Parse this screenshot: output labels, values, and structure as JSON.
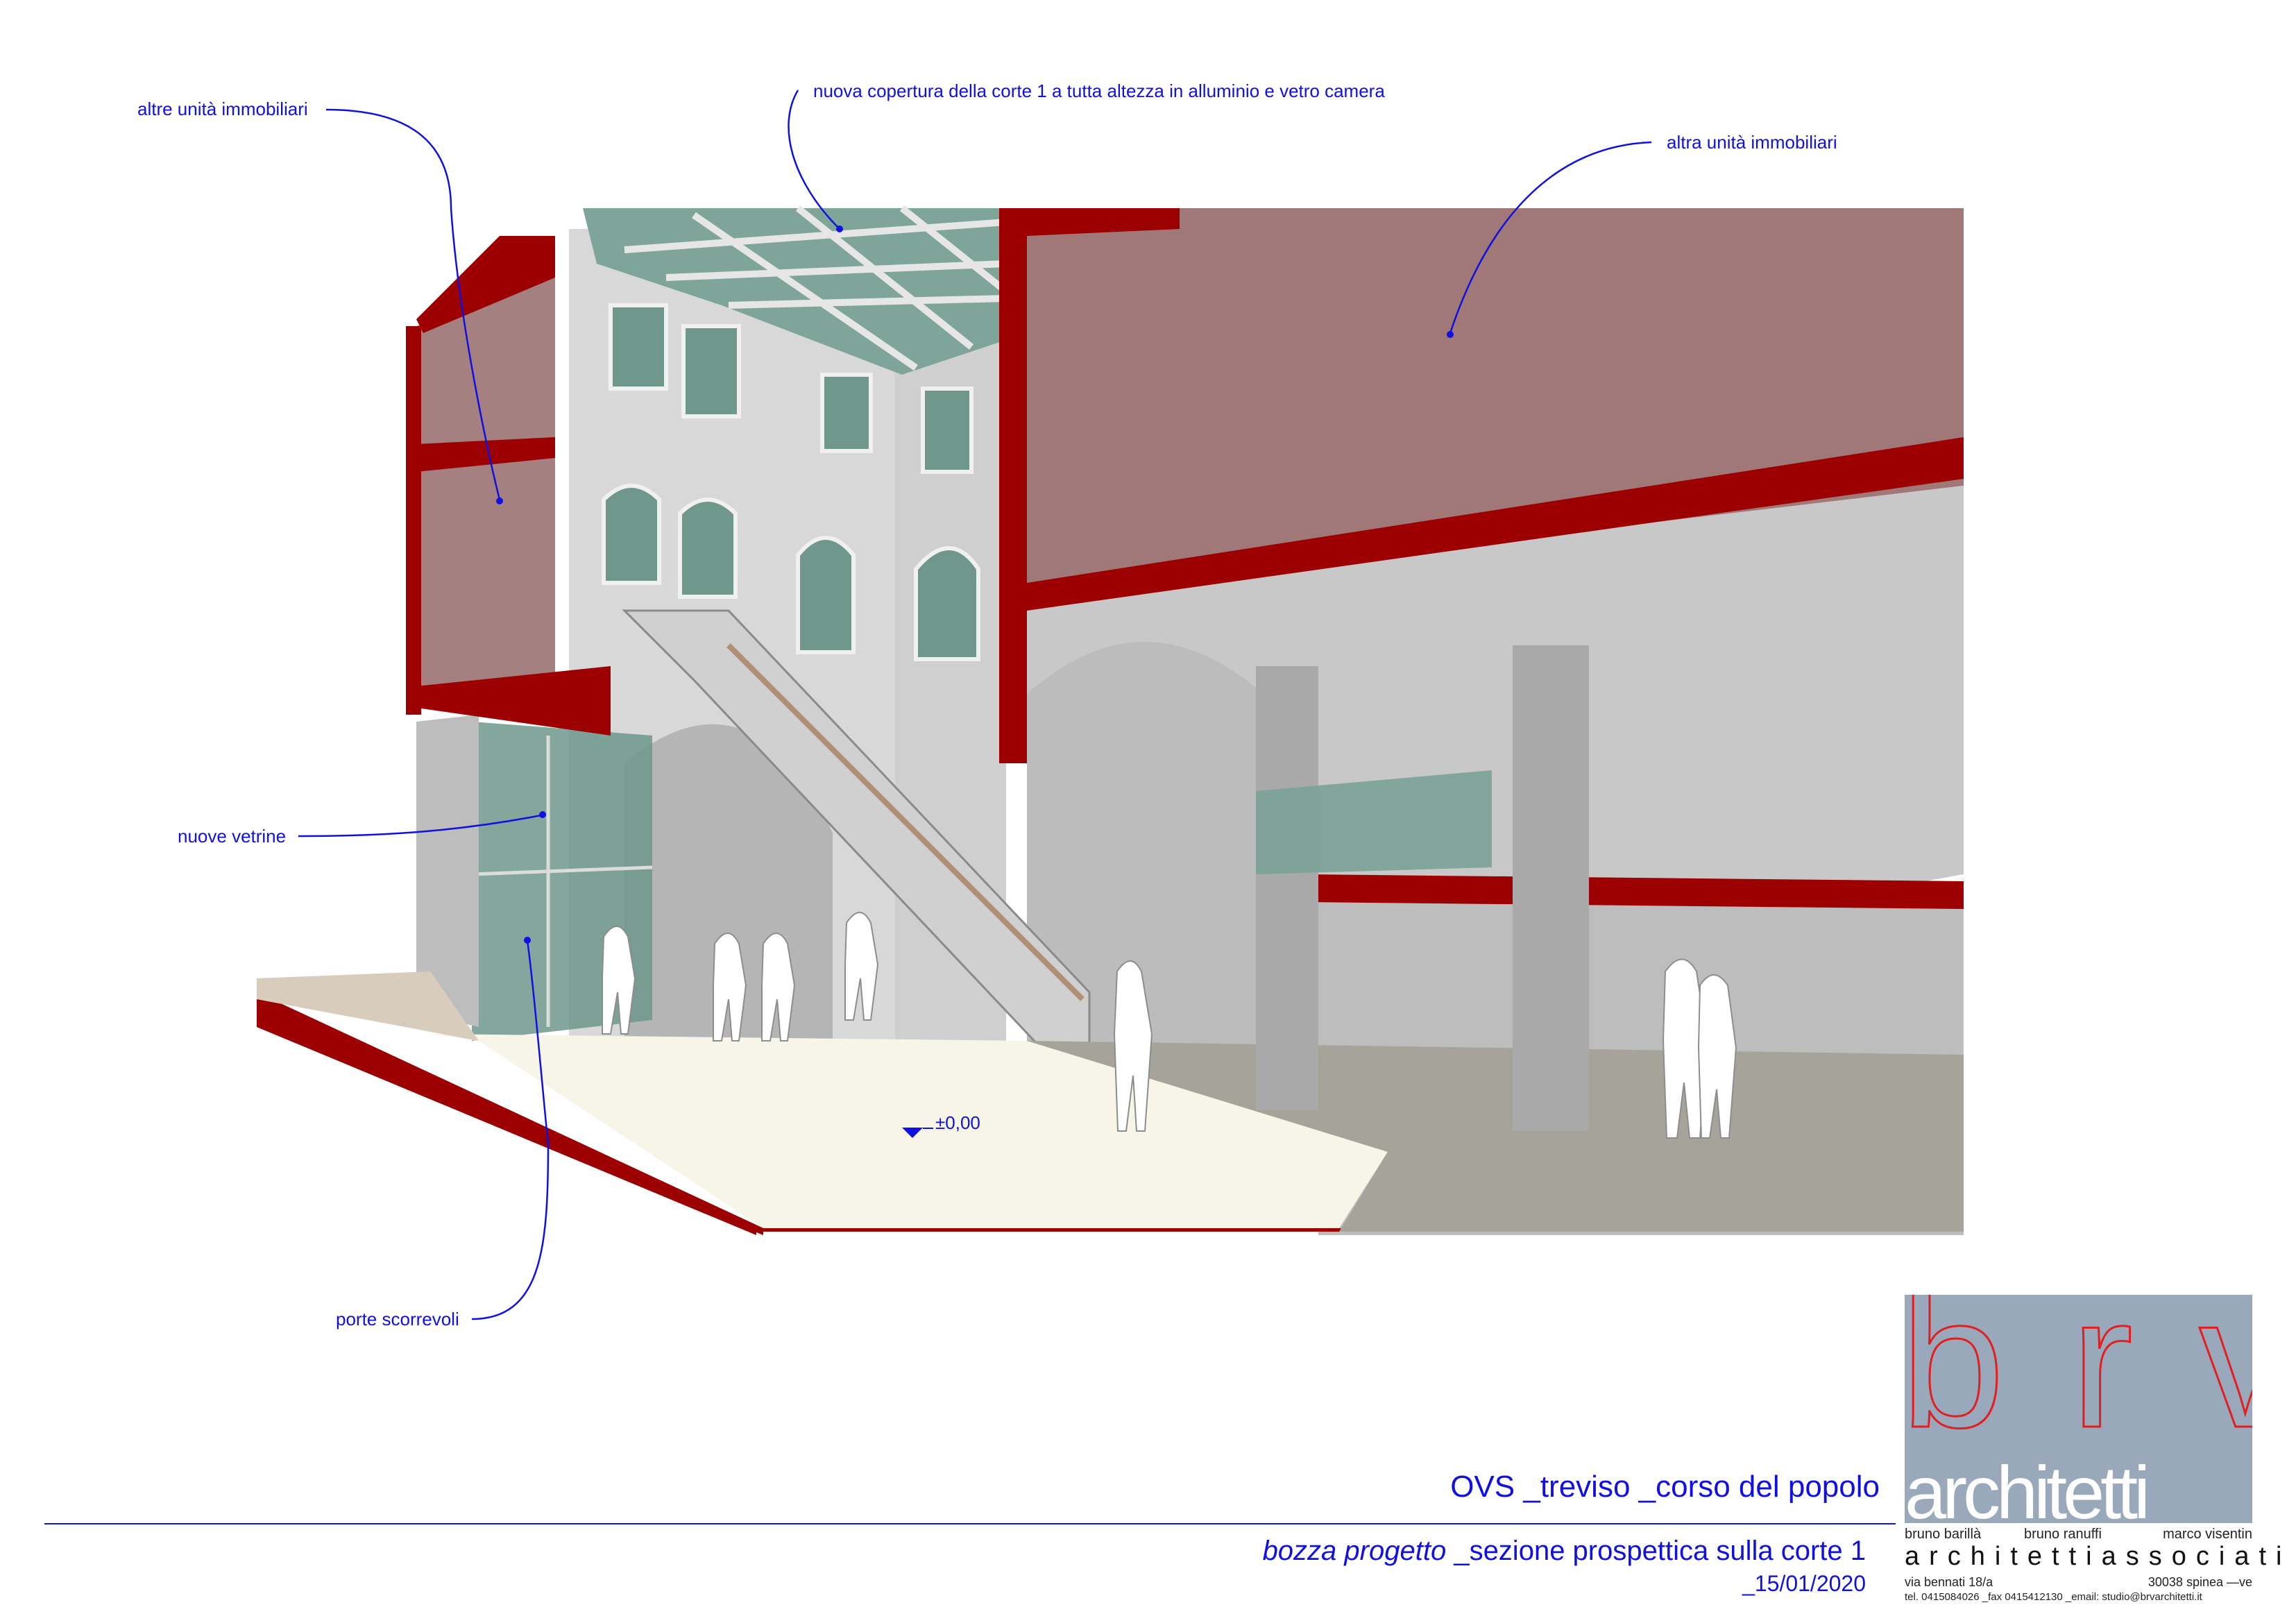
{
  "annotations": {
    "altre_unita": "altre unità immobiliari",
    "nuova_copertura": "nuova copertura della corte 1 a tutta altezza in alluminio e vetro camera",
    "altra_unita": "altra unità immobiliari",
    "nuove_vetrine": "nuove vetrine",
    "porte_scorrevoli": "porte scorrevoli",
    "level_mark": "±0,00"
  },
  "title_block": {
    "project": "OVS _treviso _corso del popolo",
    "subtitle_italic": "bozza progetto",
    "subtitle_rest": " _sezione prospettica sulla corte 1",
    "date": "_15/01/2020"
  },
  "logo": {
    "letters": "b r v",
    "word": "architetti",
    "partners": [
      "bruno barillà",
      "bruno ranuffi",
      "marco visentin"
    ],
    "associates": "architettiassociati",
    "address_left": "via bennati 18/a",
    "address_right": "30038 spinea —ve",
    "contacts": "tel. 0415084026 _fax 0415412130 _email: studio@brvarchitetti.it"
  },
  "colors": {
    "annotation_blue": "#1010e0",
    "section_red": "#9c0000",
    "logo_bg": "#9aa8bc",
    "logo_red": "#e02020"
  }
}
